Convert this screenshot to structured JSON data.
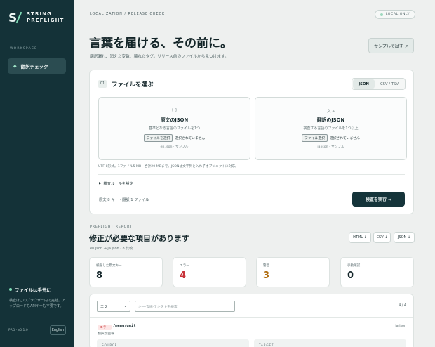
{
  "brand": {
    "line1": "STRING",
    "line2": "PREFLIGHT",
    "mark": "S/"
  },
  "sidebar": {
    "section_label": "WORKSPACE",
    "nav_item": {
      "icon": "diamond-icon",
      "label": "翻訳チェック"
    },
    "local_title": "ファイルは手元に",
    "local_desc": "検査はこのブラウザー内で完結。アップロードもAPIキーも不要です。",
    "version": "PRD · v0.1.0",
    "language_button": "English"
  },
  "header": {
    "breadcrumb": "LOCALIZATION / RELEASE CHECK",
    "badge": "LOCAL ONLY",
    "title": "言葉を届ける、その前に。",
    "subtitle": "翻訳漏れ、消えた変数、壊れたタグ。リリース前のファイルから見つけます。",
    "sample_button": "サンプルで試す ↗"
  },
  "file_card": {
    "step_no": "01",
    "title": "ファイルを選ぶ",
    "formats": [
      "JSON",
      "CSV / TSV"
    ],
    "active_format": "JSON",
    "source": {
      "icon": "{ }",
      "title": "原文のJSON",
      "desc": "基準となる言語のファイルを1つ",
      "button": "ファイルを選択",
      "status": "選択されていません",
      "hint": "en.json · サンプル"
    },
    "target": {
      "icon": "文 A",
      "title": "翻訳のJSON",
      "desc": "検査する言語のファイルを1つ以上",
      "button": "ファイル選択",
      "status": "選択されていません",
      "hint": "ja.json · サンプル"
    },
    "note": "UTF-8形式。1ファイル5 MB・合計20 MBまで。JSONは文字列と入れ子オブジェクトに対応。",
    "rules_toggle": "検査ルールを設定",
    "count_line": "原文 8 キー · 翻訳 1 ファイル",
    "run_button": "検査を実行 →"
  },
  "report": {
    "label": "PREFLIGHT REPORT",
    "title": "修正が必要な項目があります",
    "subtitle": "en.json → ja.json · 8 比較",
    "exports": [
      "HTML ↓",
      "CSV ↓",
      "JSON ↓"
    ],
    "stats": [
      {
        "label": "検査した原文キー",
        "value": "8",
        "color": "#14262a"
      },
      {
        "label": "エラー",
        "value": "4",
        "color": "#c8343a"
      },
      {
        "label": "警告",
        "value": "3",
        "color": "#b06d10"
      },
      {
        "label": "手動確認",
        "value": "0",
        "color": "#14262a"
      }
    ],
    "filter": {
      "selected": "エラー",
      "search_placeholder": "キー·言語·テキストを検索",
      "pager": "4 / 4"
    },
    "row": {
      "badge": "エラー",
      "key": "/menu/quit",
      "desc": "翻訳が空欄",
      "file": "ja.json",
      "col_source": "SOURCE",
      "col_target": "TARGET"
    }
  }
}
